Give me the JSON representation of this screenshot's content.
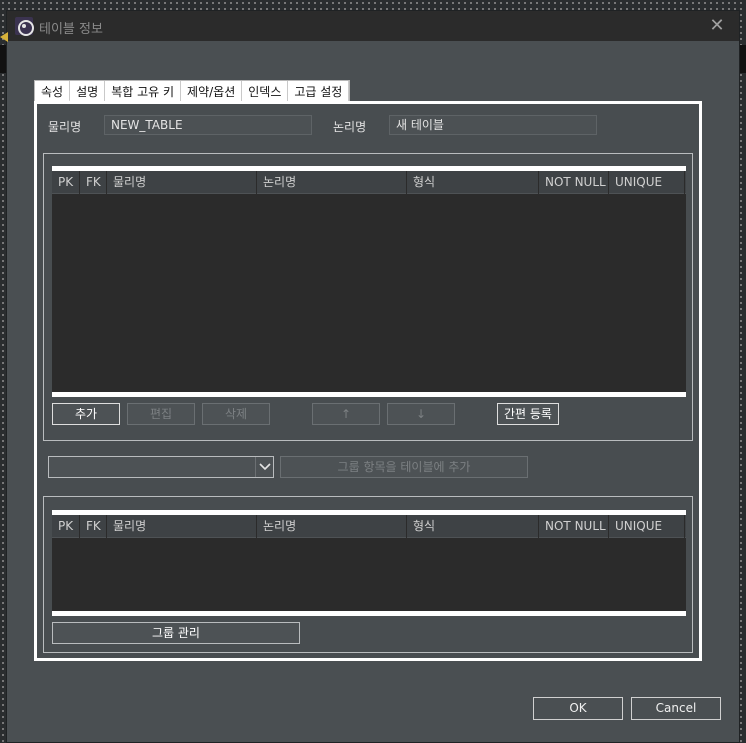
{
  "window": {
    "title": "테이블 정보",
    "close_symbol": "✕"
  },
  "tabs": [
    {
      "label": "속성",
      "active": true
    },
    {
      "label": "설명"
    },
    {
      "label": "복합 고유 키"
    },
    {
      "label": "제약/옵션"
    },
    {
      "label": "인덱스"
    },
    {
      "label": "고급 설정"
    }
  ],
  "properties": {
    "physical_name_label": "물리명",
    "physical_name_value": "NEW_TABLE",
    "logical_name_label": "논리명",
    "logical_name_value": "새 테이블"
  },
  "columns_grid": {
    "headers": [
      "PK",
      "FK",
      "물리명",
      "논리명",
      "형식",
      "NOT NULL",
      "UNIQUE"
    ]
  },
  "column_buttons": {
    "add": "추가",
    "edit": "편집",
    "delete": "삭제",
    "up": "↑",
    "down": "↓",
    "quick_register": "간편 등록"
  },
  "group": {
    "selected": "",
    "add_to_table": "그룹 항목을 테이블에 추가",
    "headers": [
      "PK",
      "FK",
      "물리명",
      "논리명",
      "형식",
      "NOT NULL",
      "UNIQUE"
    ],
    "manage": "그룹 관리"
  },
  "footer": {
    "ok": "OK",
    "cancel": "Cancel"
  },
  "colors": {
    "dialog_bg": "#4a4f52",
    "grid_bg": "#2b2b2b",
    "header_bg": "#3e4245"
  }
}
